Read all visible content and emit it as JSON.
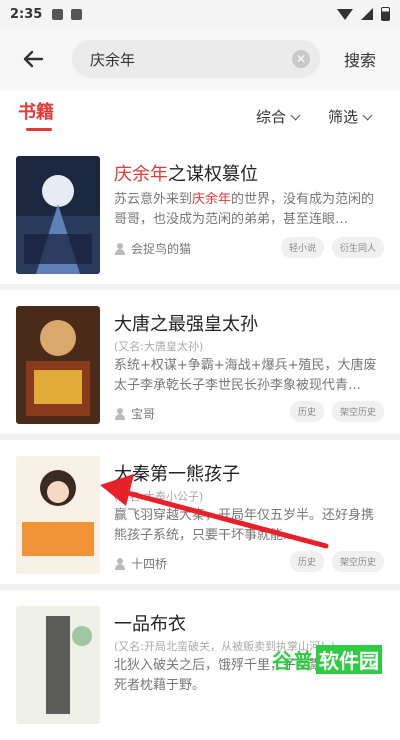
{
  "status": {
    "time": "2:35"
  },
  "search": {
    "query": "庆余年",
    "button_label": "搜索"
  },
  "tabs": {
    "books": "书籍",
    "sort": "综合",
    "filter": "筛选"
  },
  "books": [
    {
      "title_highlight": "庆余年",
      "title_rest": "之谋权篡位",
      "alias": "",
      "desc_a": "苏云意外来到",
      "desc_hl": "庆余年",
      "desc_b": "的世界，没有成为范闲的哥哥，也没成为范闲的弟弟，甚至连眼…",
      "author": "会捉鸟的猫",
      "tags": [
        "轻小说",
        "衍生同人"
      ]
    },
    {
      "title": "大唐之最强皇太孙",
      "alias": "(又名:大唐皇太孙)",
      "desc": "系统+权谋+争霸+海战+爆兵+殖民，大唐废太子李承乾长子李世民长孙李象被现代青…",
      "author": "宝哥",
      "tags": [
        "历史",
        "架空历史"
      ]
    },
    {
      "title": "大秦第一熊孩子",
      "alias": "(又名:大秦小公子)",
      "desc": "赢飞羽穿越大秦，开局年仅五岁半。还好身携熊孩子系统，只要干坏事就能…",
      "author": "十四桥",
      "tags": [
        "历史",
        "架空历史"
      ]
    },
    {
      "title": "一品布衣",
      "alias": "(又名:开局北蛮破关，从被贩卖到执掌山河！)",
      "desc": "北狄入破关之后，饿殍千里，子女鬻卖牛羊，死者枕藉于野。",
      "author": "",
      "tags": []
    }
  ],
  "watermark": {
    "text": "谷普",
    "box": "软件园"
  },
  "colors": {
    "accent": "#e53935",
    "watermark": "#2ecc40"
  }
}
